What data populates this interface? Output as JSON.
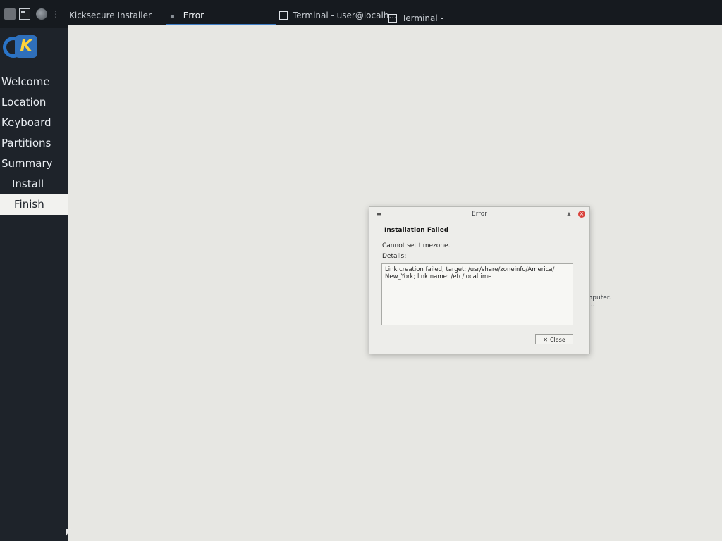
{
  "taskbar": {
    "icons": [
      "file-manager-icon",
      "terminal-icon",
      "browser-icon"
    ],
    "tasks": [
      {
        "label": "Kicksecure Installer",
        "active": false
      },
      {
        "label": "Error",
        "active": true
      },
      {
        "label": "Terminal - user@localh...",
        "active": false
      },
      {
        "label": "Terminal -",
        "active": false
      }
    ]
  },
  "sidebar": {
    "items": [
      {
        "label": "Welcome"
      },
      {
        "label": "Location"
      },
      {
        "label": "Keyboard"
      },
      {
        "label": "Partitions"
      },
      {
        "label": "Summary"
      },
      {
        "label": "Install"
      },
      {
        "label": "Finish"
      }
    ],
    "active_item": "Finish"
  },
  "background": {
    "peek_line1": "omputer.",
    "peek_line2": "ne.."
  },
  "dialog": {
    "title": "Error",
    "heading": "Installation Failed",
    "message": "Cannot set timezone.",
    "details_label": "Details:",
    "details_text": "Link creation failed, target: /usr/share/zoneinfo/America/ New_York; link name: /etc/localtime",
    "close_label": "Close"
  },
  "colors": {
    "accent": "#3f7dc4",
    "close_button": "#d9413a",
    "sidebar_bg": "#1e232a"
  }
}
